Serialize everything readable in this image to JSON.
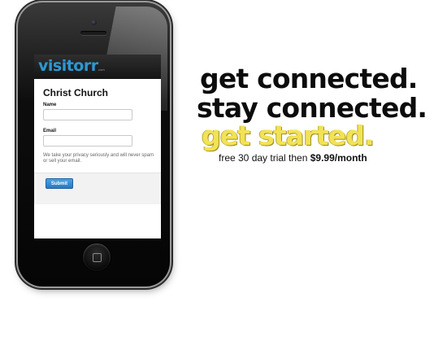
{
  "phone": {
    "app": {
      "logo": "visitorr",
      "logo_small": ".com"
    },
    "form": {
      "church_name": "Christ Church",
      "name_label": "Name",
      "name_value": "",
      "email_label": "Email",
      "email_value": "",
      "privacy_note": "We take your privacy seriously and will never spam or sell your email.",
      "submit_label": "Submit"
    }
  },
  "tagline": {
    "line1": "get connected.",
    "line2": "stay connected.",
    "line3": "get started.",
    "pricing_prefix": "free 30 day trial then ",
    "pricing_price": "$9.99/month"
  },
  "colors": {
    "brand_blue": "#2d98d2",
    "accent_yellow": "#f2e255",
    "button_blue": "#2a78c4"
  }
}
